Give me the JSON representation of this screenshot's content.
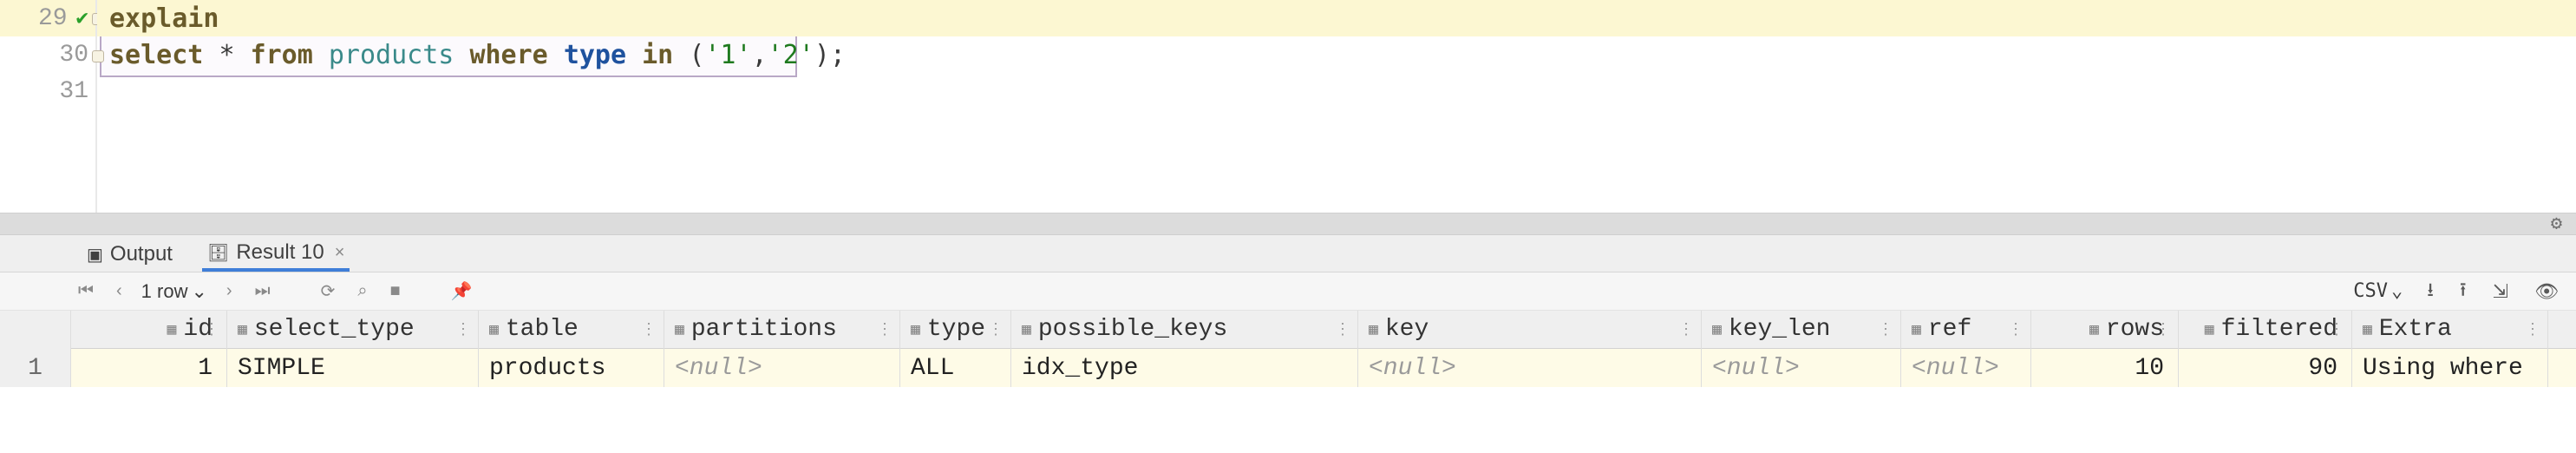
{
  "editor": {
    "lines": [
      {
        "n": 29,
        "has_check": true
      },
      {
        "n": 30,
        "has_check": false
      },
      {
        "n": 31,
        "has_check": false
      }
    ],
    "sql": {
      "explain": "explain",
      "select": "select",
      "star": "*",
      "from": "from",
      "table": "products",
      "where": "where",
      "col": "type",
      "in": "in",
      "lp": "(",
      "v1": "'1'",
      "comma": ",",
      "v2": "'2'",
      "rp": ")",
      "semi": ";"
    }
  },
  "tabs": {
    "output": {
      "label": "Output"
    },
    "result": {
      "label": "Result 10"
    }
  },
  "toolbar": {
    "first": "⏮",
    "prev": "‹",
    "row_count": "1 row",
    "row_chev": "⌄",
    "next": "›",
    "last": "⏭",
    "reload": "⟳",
    "find": "⌕",
    "stop": "■",
    "pin": "📌",
    "csv_label": "CSV",
    "csv_chev": "⌄",
    "download": "⭳",
    "upload": "⭱",
    "split": "⇲",
    "view": "👁"
  },
  "splitter": {
    "gear": "⚙"
  },
  "grid": {
    "columns": [
      "id",
      "select_type",
      "table",
      "partitions",
      "type",
      "possible_keys",
      "key",
      "key_len",
      "ref",
      "rows",
      "filtered",
      "Extra"
    ],
    "row_number": "1",
    "row": {
      "id": "1",
      "select_type": "SIMPLE",
      "table": "products",
      "partitions": "<null>",
      "type": "ALL",
      "possible_keys": "idx_type",
      "key": "<null>",
      "key_len": "<null>",
      "ref": "<null>",
      "rows": "10",
      "filtered": "90",
      "Extra": "Using where"
    }
  },
  "icons": {
    "column": "▦",
    "sort": "⋮",
    "check": "✔",
    "close": "×",
    "db": "🗄",
    "out": "▣"
  }
}
